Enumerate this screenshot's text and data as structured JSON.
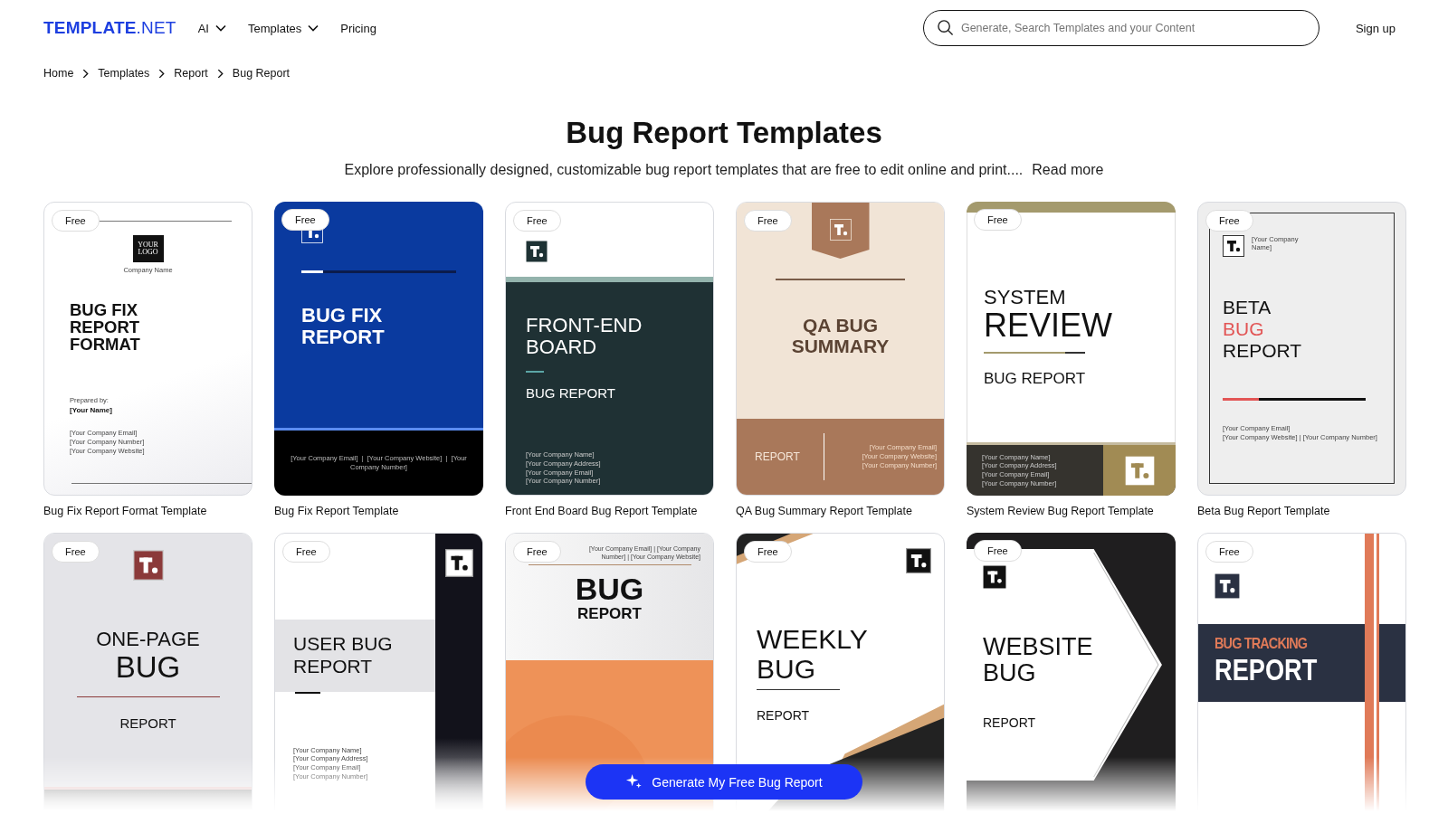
{
  "header": {
    "logo": "**TEMPLATE**.NET",
    "nav": [
      {
        "label": "AI",
        "dropdown": true
      },
      {
        "label": "Templates",
        "dropdown": true
      },
      {
        "label": "Pricing",
        "dropdown": false
      }
    ],
    "search": {
      "placeholder": "Generate, Search Templates and your Content"
    },
    "sign_up": "Sign up"
  },
  "breadcrumb": [
    "Home",
    "Templates",
    "Report",
    "Bug Report"
  ],
  "title": "Bug Report Templates",
  "intro": "Explore professionally designed, customizable bug report templates that are free to edit online and print....",
  "read_more": "Read more",
  "templates": [
    {
      "name": "Bug Fix Report Format Template",
      "badge": "Free",
      "thumb": {
        "kind": "format",
        "logo_text": "YOUR LOGO",
        "company": "Company Name",
        "title": [
          "BUG FIX",
          "REPORT",
          "FORMAT"
        ],
        "prepared_label": "Prepared by:",
        "prepared_name": "[Your Name]",
        "lines": [
          "[Your Company Email]",
          "[Your Company Number]",
          "[Your Company Website]"
        ]
      }
    },
    {
      "name": "Bug Fix Report Template",
      "badge": "Free",
      "thumb": {
        "kind": "blue",
        "title": [
          "BUG FIX",
          "REPORT"
        ],
        "lines": [
          "[Your Company Email]  |  [Your Company Website]  |  [Your Company Number]"
        ]
      }
    },
    {
      "name": "Front End Board Bug Report Template",
      "badge": "Free",
      "thumb": {
        "kind": "green",
        "title": [
          "FRONT-END",
          "BOARD"
        ],
        "subtitle": "BUG REPORT",
        "lines": [
          "[Your Company Name]",
          "[Your Company Address]",
          "[Your Company Email]",
          "[Your Company Number]"
        ]
      }
    },
    {
      "name": "QA Bug Summary Report Template",
      "badge": "Free",
      "thumb": {
        "kind": "beige",
        "title": [
          "QA BUG",
          "SUMMARY"
        ],
        "subtitle": "REPORT",
        "lines": [
          "[Your Company Email]",
          "[Your Company Website]",
          "[Your Company Number]"
        ]
      }
    },
    {
      "name": "System Review Bug Report Template",
      "badge": "Free",
      "thumb": {
        "kind": "system",
        "title": [
          "SYSTEM",
          "REVIEW"
        ],
        "subtitle": "BUG REPORT",
        "lines": [
          "[Your Company Name]",
          "[Your Company Address]",
          "[Your Company Email]",
          "[Your Company Number]"
        ]
      }
    },
    {
      "name": "Beta Bug Report Template",
      "badge": "Free",
      "thumb": {
        "kind": "beta",
        "company": "[Your Company Name]",
        "title": [
          "BETA"
        ],
        "accent": "BUG",
        "subtitle": "REPORT",
        "lines": [
          "[Your Company Email]",
          "[Your Company Website]  |  [Your Company Number]"
        ]
      }
    },
    {
      "badge": "Free",
      "thumb": {
        "kind": "onepage",
        "title": [
          "ONE-PAGE",
          "BUG"
        ],
        "subtitle": "REPORT"
      }
    },
    {
      "badge": "Free",
      "thumb": {
        "kind": "user",
        "title": [
          "USER BUG",
          "REPORT"
        ],
        "lines": [
          "[Your Company Name]",
          "[Your Company Address]",
          "[Your Company Email]",
          "[Your Company Number]"
        ]
      }
    },
    {
      "badge": "Free",
      "thumb": {
        "kind": "orange",
        "lines": [
          "[Your Company Email] | [Your Company Number] | [Your Company Website]"
        ],
        "title": [
          "BUG"
        ],
        "subtitle": "REPORT"
      }
    },
    {
      "badge": "Free",
      "thumb": {
        "kind": "weekly",
        "title": [
          "WEEKLY",
          "BUG"
        ],
        "subtitle": "REPORT"
      }
    },
    {
      "badge": "Free",
      "thumb": {
        "kind": "website",
        "title": [
          "WEBSITE",
          "BUG"
        ],
        "subtitle": "REPORT"
      }
    },
    {
      "badge": "Free",
      "thumb": {
        "kind": "tracking",
        "accent": "BUG TRACKING",
        "title": [
          "REPORT"
        ]
      }
    }
  ],
  "generate_button": "Generate My Free Bug Report"
}
